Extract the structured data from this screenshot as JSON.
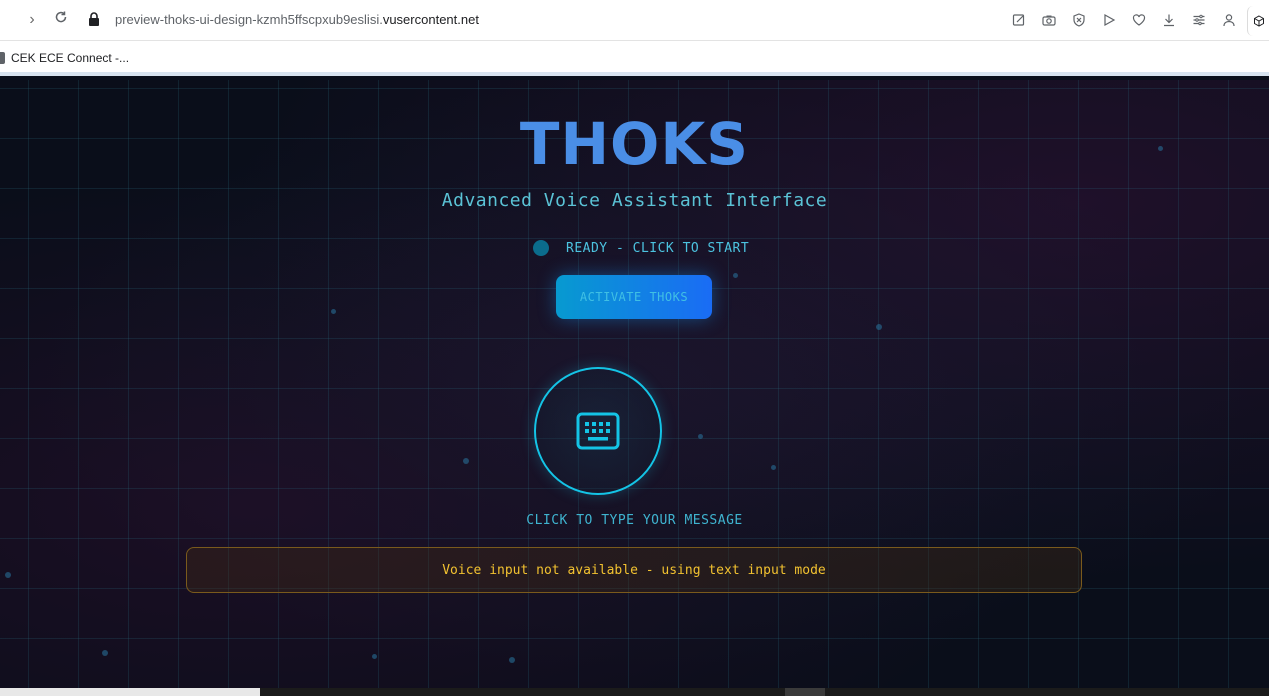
{
  "browser": {
    "url_prefix": "preview-thoks-ui-design-kzmh5ffscpxub9eslisi.",
    "url_domain": "vusercontent.net",
    "toolbar_icons": [
      "edit-icon",
      "camera-icon",
      "shield-icon",
      "play-icon",
      "heart-icon",
      "download-icon",
      "sliders-icon",
      "profile-icon"
    ]
  },
  "bookmarks": {
    "items": [
      {
        "label": "CEK ECE Connect -..."
      }
    ]
  },
  "app": {
    "title": "THOKS",
    "subtitle": "Advanced Voice Assistant Interface",
    "status_text": "READY - CLICK TO START",
    "activate_label": "ACTIVATE THOKS",
    "keyboard_hint": "CLICK TO TYPE YOUR MESSAGE",
    "warning": "Voice input not available - using text input mode",
    "colors": {
      "title": "#4a8ee6",
      "accent": "#14c4e6",
      "warning": "#f2c230"
    }
  }
}
